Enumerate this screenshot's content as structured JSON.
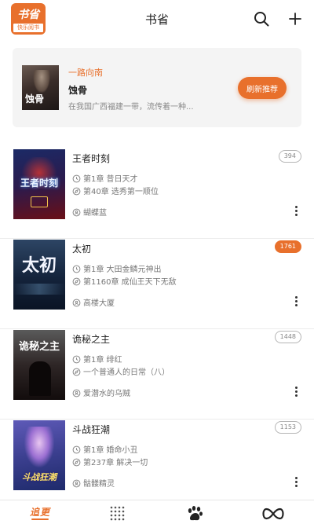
{
  "app": {
    "logo_top": "书省",
    "logo_bottom": "快乐阅书",
    "title": "书省"
  },
  "icons": {
    "search": "search-icon",
    "add": "plus-icon",
    "chapter": "clock-icon",
    "latest": "compass-icon",
    "author": "user-icon",
    "more": "more-vertical-icon"
  },
  "colors": {
    "accent": "#e8702c",
    "text": "#222222",
    "muted": "#777777"
  },
  "recommend": {
    "tag": "一路向南",
    "book_title": "蚀骨",
    "cover_text": "蚀骨",
    "description": "在我国广西福建一带，流传着一种...",
    "button_label": "刷新推荐"
  },
  "books": [
    {
      "title": "王者时刻",
      "cover_text": "王者时刻",
      "first_chapter": "第1章 昔日天才",
      "latest_chapter": "第40章 选秀第一顺位",
      "author": "蝴蝶蓝",
      "count": "394",
      "highlight": false
    },
    {
      "title": "太初",
      "cover_text": "太初",
      "first_chapter": "第1章 大田金鳞元神出",
      "latest_chapter": "第1160章 成仙王天下无敌",
      "author": "高楼大厦",
      "count": "1761",
      "highlight": true
    },
    {
      "title": "诡秘之主",
      "cover_text": "诡秘之主",
      "first_chapter": "第1章 绯红",
      "latest_chapter": "一个普通人的日常（八）",
      "author": "爱潜水的乌贼",
      "count": "1448",
      "highlight": false
    },
    {
      "title": "斗战狂潮",
      "cover_text": "斗战狂潮",
      "first_chapter": "第1章 婚命小丑",
      "latest_chapter": "第237章 解决一切",
      "author": "骷髅精灵",
      "count": "1153",
      "highlight": false
    }
  ],
  "tabs": [
    {
      "label": "追更",
      "icon": "bookshelf-tab-icon",
      "active": true
    },
    {
      "icon": "grid-dots-tab-icon",
      "active": false
    },
    {
      "icon": "paw-tab-icon",
      "active": false
    },
    {
      "icon": "infinity-tab-icon",
      "active": false
    }
  ]
}
